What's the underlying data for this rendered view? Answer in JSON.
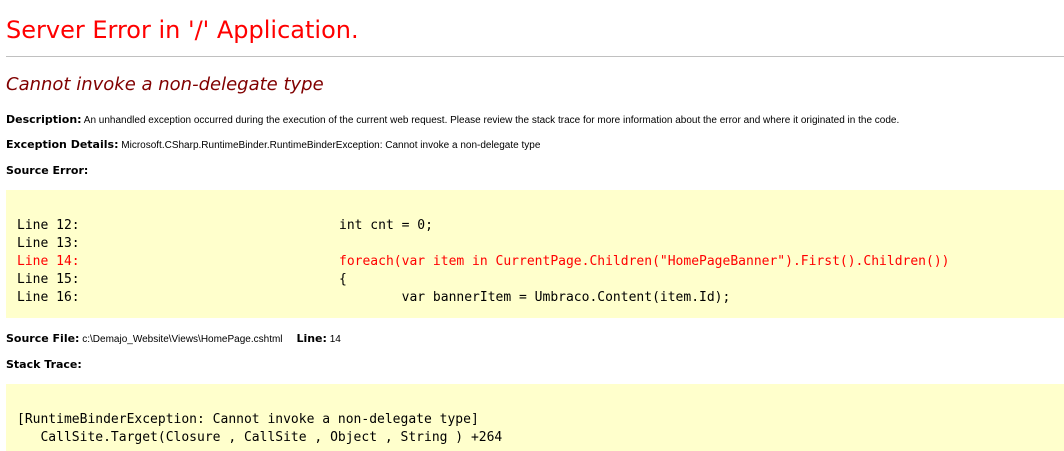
{
  "header": {
    "title": "Server Error in '/' Application.",
    "subtitle": "Cannot invoke a non-delegate type"
  },
  "description": {
    "label": "Description:",
    "text": "An unhandled exception occurred during the execution of the current web request. Please review the stack trace for more information about the error and where it originated in the code."
  },
  "exception": {
    "label": "Exception Details:",
    "text": "Microsoft.CSharp.RuntimeBinder.RuntimeBinderException: Cannot invoke a non-delegate type"
  },
  "source_error": {
    "label": "Source Error:",
    "lines": [
      {
        "number": "Line 12:",
        "code": "int cnt = 0;",
        "is_error": false
      },
      {
        "number": "Line 13:",
        "code": "",
        "is_error": false
      },
      {
        "number": "Line 14:",
        "code": "foreach(var item in CurrentPage.Children(\"HomePageBanner\").First().Children())",
        "is_error": true
      },
      {
        "number": "Line 15:",
        "code": "{",
        "is_error": false
      },
      {
        "number": "Line 16:",
        "code": "        var bannerItem = Umbraco.Content(item.Id);",
        "is_error": false
      }
    ]
  },
  "source_file": {
    "label": "Source File:",
    "path": "c:\\Demajo_Website\\Views\\HomePage.cshtml",
    "line_label": "Line:",
    "line_number": "14"
  },
  "stack_trace": {
    "label": "Stack Trace:",
    "lines": [
      "[RuntimeBinderException: Cannot invoke a non-delegate type]",
      "   CallSite.Target(Closure , CallSite , Object , String ) +264"
    ]
  },
  "colors": {
    "title": "#ff0000",
    "subtitle": "#800000",
    "code_background": "#ffffcc",
    "error_line": "#ff0000",
    "rule": "#c0c0c0"
  }
}
